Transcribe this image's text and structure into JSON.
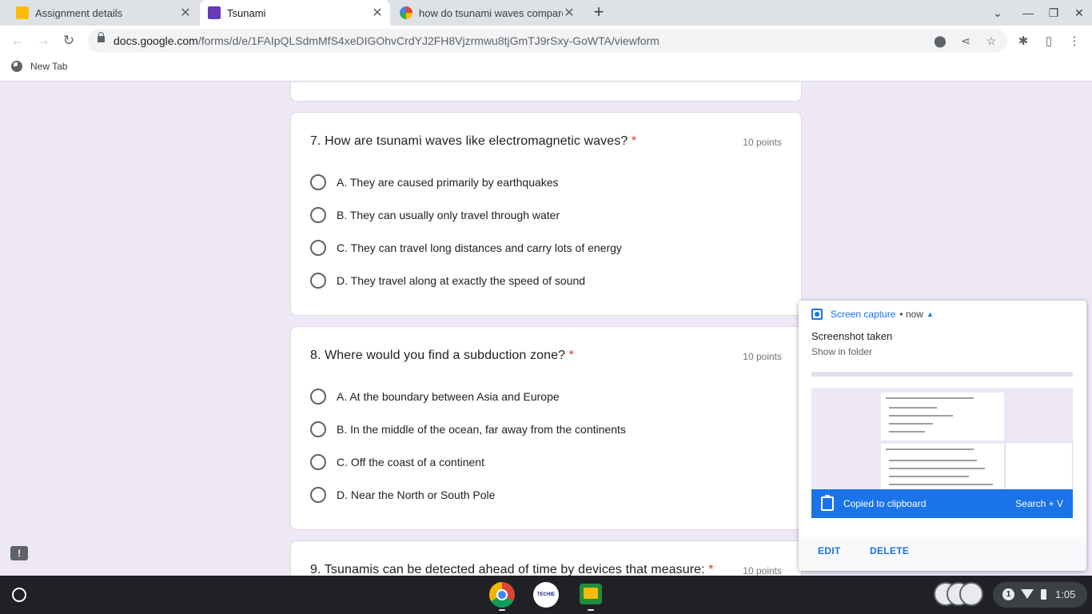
{
  "tabs": [
    {
      "title": "Assignment details",
      "icon": "classroom-icon",
      "active": false
    },
    {
      "title": "Tsunami",
      "icon": "forms-icon",
      "active": true
    },
    {
      "title": "how do tsunami waves compare",
      "icon": "google-icon",
      "active": false
    }
  ],
  "toolbar": {
    "url_domain": "docs.google.com",
    "url_path": "/forms/d/e/1FAIpQLSdmMfS4xeDIGOhvCrdYJ2FH8Vjzrmwu8tjGmTJ9rSxy-GoWTA/viewform"
  },
  "bookmarks": [
    {
      "label": "New Tab"
    }
  ],
  "questions": [
    {
      "title": "7. How are tsunami waves like electromagnetic waves?",
      "required": "*",
      "points": "10 points",
      "options": [
        "A. They are caused primarily by earthquakes",
        "B. They can usually only travel through water",
        "C. They can travel long distances and carry lots of energy",
        "D. They travel along at exactly the speed of sound"
      ]
    },
    {
      "title": "8. Where would you find a subduction zone?",
      "required": "*",
      "points": "10 points",
      "options": [
        "A. At the boundary between Asia and Europe",
        "B. In the middle of the ocean, far away from the continents",
        "C. Off the coast of a continent",
        "D. Near the North or South Pole"
      ]
    },
    {
      "title": "9. Tsunamis can be detected ahead of time by devices that measure:",
      "required": "*",
      "points": "10 points"
    }
  ],
  "notification": {
    "app": "Screen capture",
    "time": "now",
    "title": "Screenshot taken",
    "subtitle": "Show in folder",
    "clipboard_text": "Copied to clipboard",
    "shortcut": "Search + V",
    "actions": [
      "EDIT",
      "DELETE"
    ]
  },
  "shelf": {
    "apps": [
      "chrome-icon",
      "techie-icon",
      "classroom-icon"
    ],
    "notification_count": "1",
    "time": "1:05"
  },
  "colors": {
    "page_bg": "#ede7f6",
    "required": "#d93025",
    "accent": "#1a73e8",
    "shelf": "#202124"
  }
}
